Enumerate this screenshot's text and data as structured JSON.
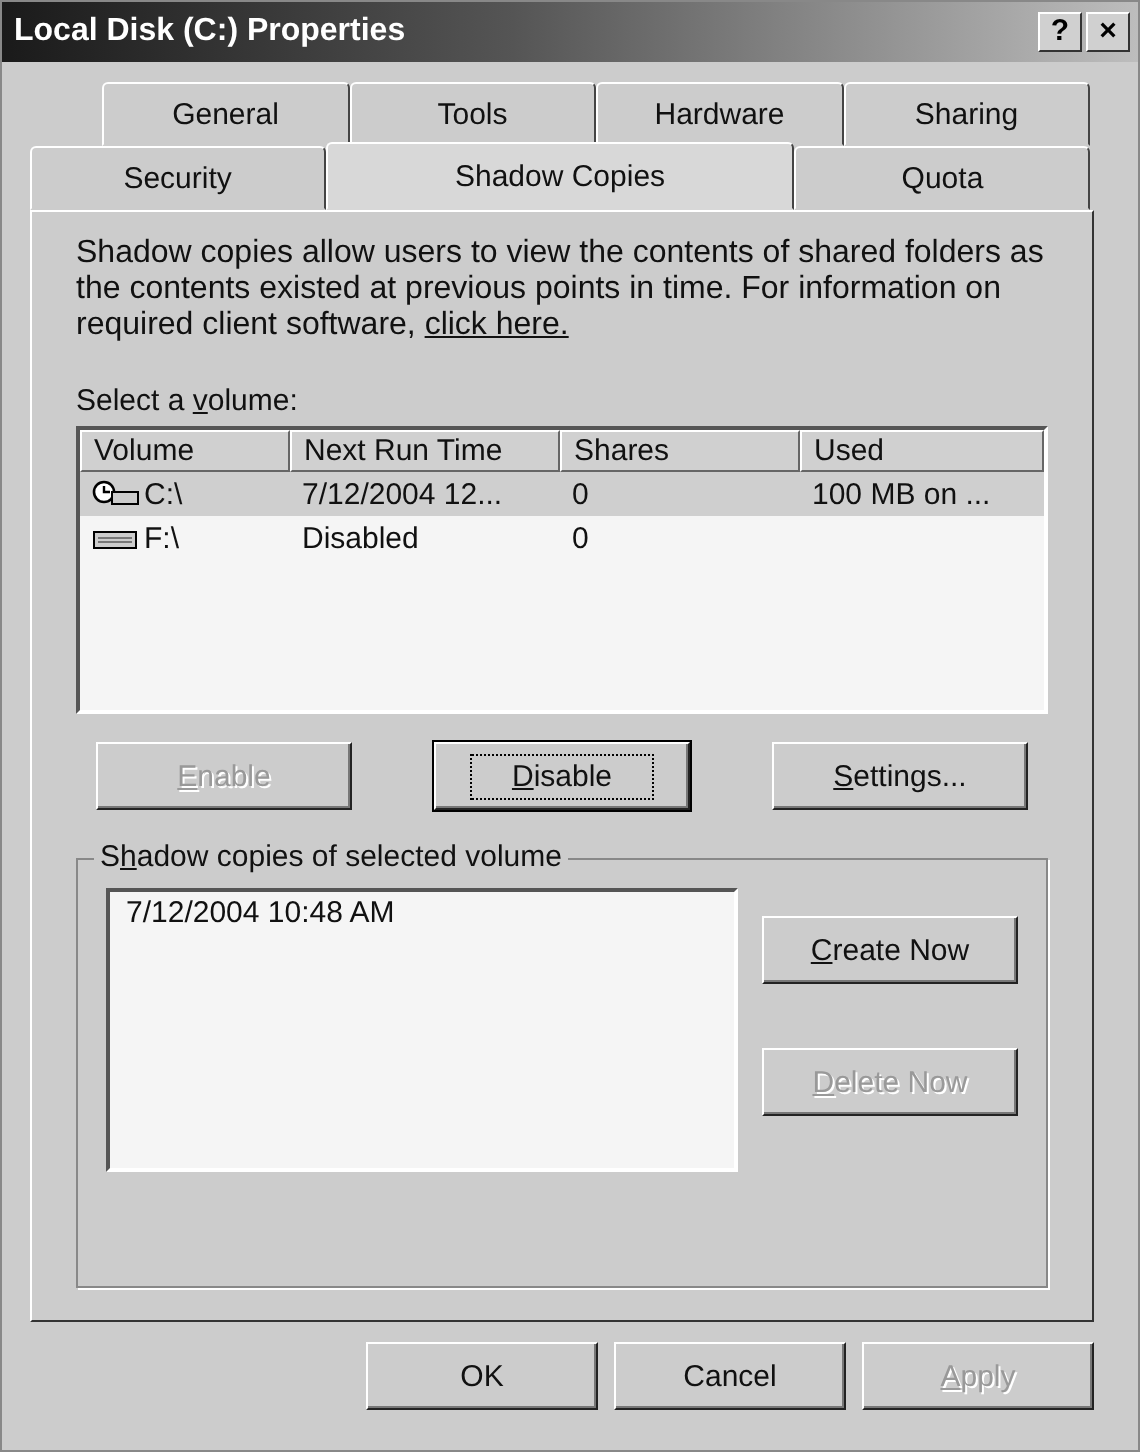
{
  "window": {
    "title": "Local Disk (C:) Properties",
    "help_button": "?",
    "close_button": "×"
  },
  "tab_rows": [
    [
      {
        "label": "General",
        "selected": false
      },
      {
        "label": "Tools",
        "selected": false
      },
      {
        "label": "Hardware",
        "selected": false
      },
      {
        "label": "Sharing",
        "selected": false
      }
    ],
    [
      {
        "label": "Security",
        "selected": false
      },
      {
        "label": "Shadow Copies",
        "selected": true
      },
      {
        "label": "Quota",
        "selected": false
      }
    ]
  ],
  "description": {
    "text": "Shadow copies allow users to view the contents of shared folders as the contents existed at previous points in time. For information on required client software, ",
    "link": "click here."
  },
  "volume_label": {
    "before": "Select a ",
    "key": "v",
    "after": "olume:"
  },
  "volumes": {
    "columns": [
      "Volume",
      "Next Run Time",
      "Shares",
      "Used"
    ],
    "rows": [
      {
        "kind": "scheduled",
        "selected": true,
        "cells": [
          "C:\\",
          "7/12/2004 12...",
          "0",
          "100 MB on ..."
        ]
      },
      {
        "kind": "drive",
        "selected": false,
        "cells": [
          "F:\\",
          "Disabled",
          "0"
        ]
      }
    ]
  },
  "volume_buttons": [
    {
      "key": "E",
      "after": "nable",
      "disabled": true,
      "default": false
    },
    {
      "key": "D",
      "after": "isable",
      "disabled": false,
      "default": true
    },
    {
      "key": "S",
      "after": "ettings...",
      "disabled": false,
      "default": false
    }
  ],
  "copies_group": {
    "before": "S",
    "key": "h",
    "after": "adow copies of selected volume",
    "copies": [
      "7/12/2004 10:48 AM"
    ],
    "buttons": [
      {
        "key": "C",
        "after": "reate Now",
        "disabled": false
      },
      {
        "key": "D",
        "after": "elete Now",
        "disabled": true
      }
    ]
  },
  "footer_buttons": [
    {
      "before": "OK",
      "disabled": false
    },
    {
      "before": "Cancel",
      "disabled": false
    },
    {
      "key": "A",
      "after": "pply",
      "disabled": true
    }
  ]
}
